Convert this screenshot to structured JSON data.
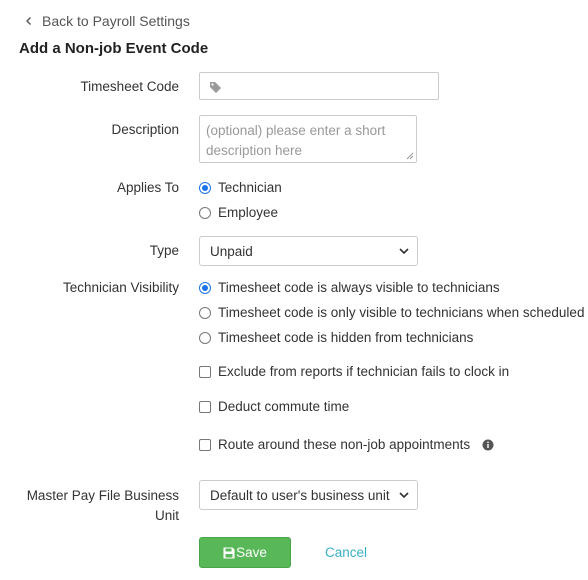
{
  "nav": {
    "back_label": "Back to Payroll Settings"
  },
  "page": {
    "title": "Add a Non-job Event Code"
  },
  "form": {
    "timesheet_code": {
      "label": "Timesheet Code",
      "value": ""
    },
    "description": {
      "label": "Description",
      "placeholder_line1": "(optional) please enter a short",
      "placeholder_line2": "description here"
    },
    "applies_to": {
      "label": "Applies To",
      "options": [
        "Technician",
        "Employee"
      ],
      "selected": "Technician"
    },
    "type": {
      "label": "Type",
      "value": "Unpaid"
    },
    "technician_visibility": {
      "label": "Technician Visibility",
      "options": [
        "Timesheet code is always visible to technicians",
        "Timesheet code is only visible to technicians when scheduled",
        "Timesheet code is hidden from technicians"
      ],
      "selected": "Timesheet code is always visible to technicians"
    },
    "checkboxes": {
      "exclude_reports": "Exclude from reports if technician fails to clock in",
      "deduct_commute": "Deduct commute time",
      "route_around": "Route around these non-job appointments"
    },
    "master_pay_file": {
      "label_line1": "Master Pay File Business",
      "label_line2": "Unit",
      "value": "Default to user's business unit"
    }
  },
  "actions": {
    "save_label": "Save",
    "cancel_label": "Cancel"
  },
  "colors": {
    "save_green": "#58b858",
    "radio_blue": "#1a73e8",
    "cancel_link": "#3ab0c7"
  }
}
